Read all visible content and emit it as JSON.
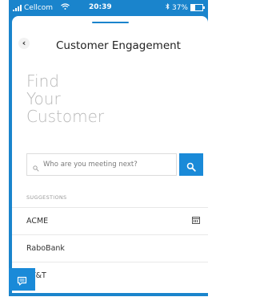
{
  "status_bar": {
    "carrier": "Cellcom",
    "time": "20:39",
    "battery": "37%",
    "signal_icon": "signal-bars-icon",
    "wifi_icon": "wifi-icon",
    "battery_icon": "battery-icon"
  },
  "header": {
    "title": "Customer Engagement",
    "back_icon": "chevron-left-icon"
  },
  "hero": {
    "line1": "Find",
    "line2": "Your",
    "line3": "Customer"
  },
  "search": {
    "placeholder": "Who are you meeting next?",
    "button_icon": "search-icon"
  },
  "suggestions": {
    "header": "SUGGESTIONS",
    "items": [
      {
        "label": "ACME",
        "icon": "calendar-icon"
      },
      {
        "label": "RaboBank"
      },
      {
        "label": "AT&T"
      }
    ]
  },
  "fab": {
    "icon": "chat-icon"
  },
  "colors": {
    "accent": "#1a84cc",
    "button": "#1a8ad8",
    "hero_text": "#b8b8b8"
  }
}
